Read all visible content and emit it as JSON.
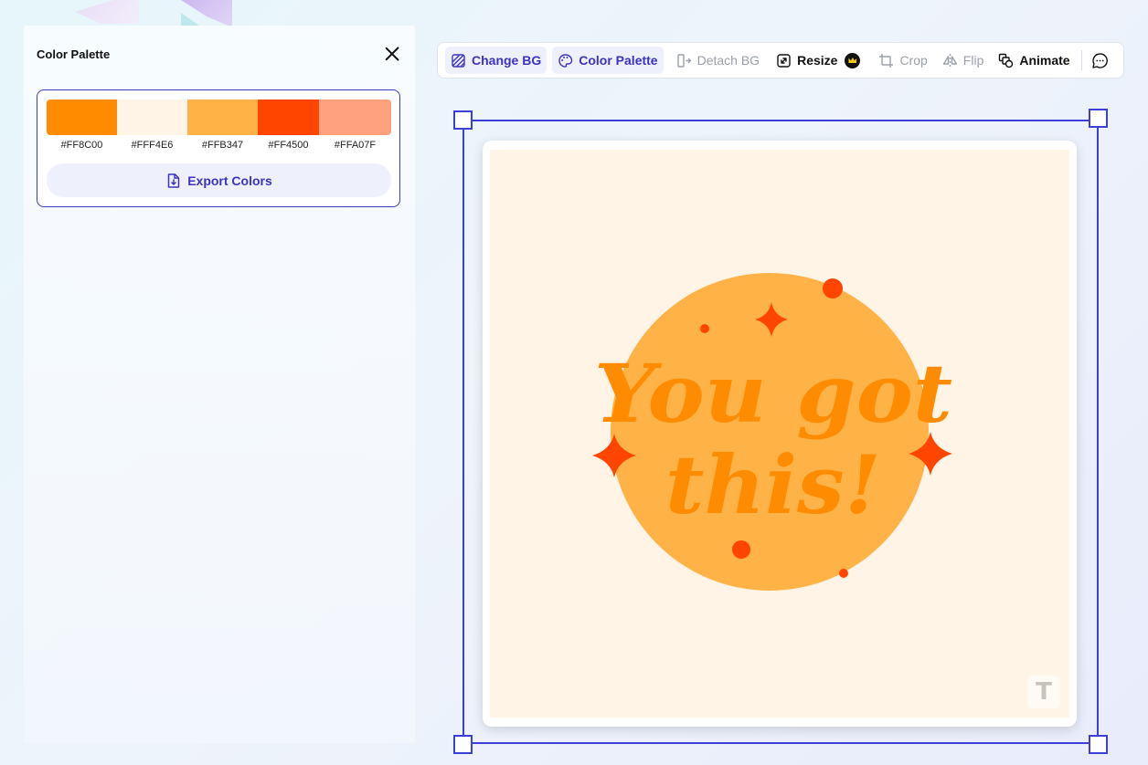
{
  "panel": {
    "title": "Color Palette",
    "export_label": "Export Colors",
    "colors": [
      {
        "hex": "#FF8C00",
        "label": "#FF8C00"
      },
      {
        "hex": "#FFF4E6",
        "label": "#FFF4E6"
      },
      {
        "hex": "#FFB347",
        "label": "#FFB347"
      },
      {
        "hex": "#FF4500",
        "label": "#FF4500"
      },
      {
        "hex": "#FFA07F",
        "label": "#FFA07F"
      }
    ]
  },
  "toolbar": {
    "change_bg": "Change BG",
    "color_palette": "Color Palette",
    "detach_bg": "Detach BG",
    "resize": "Resize",
    "crop": "Crop",
    "flip": "Flip",
    "animate": "Animate"
  },
  "artwork": {
    "line1": "You got",
    "line2": "this!",
    "watermark": "T",
    "colors": {
      "background": "#FFF4E6",
      "circle": "#FFB347",
      "text": "#FF8C00",
      "accent": "#FF4500"
    }
  },
  "colors": {
    "accent": "#3a34c0",
    "selection": "#3d40d6"
  }
}
